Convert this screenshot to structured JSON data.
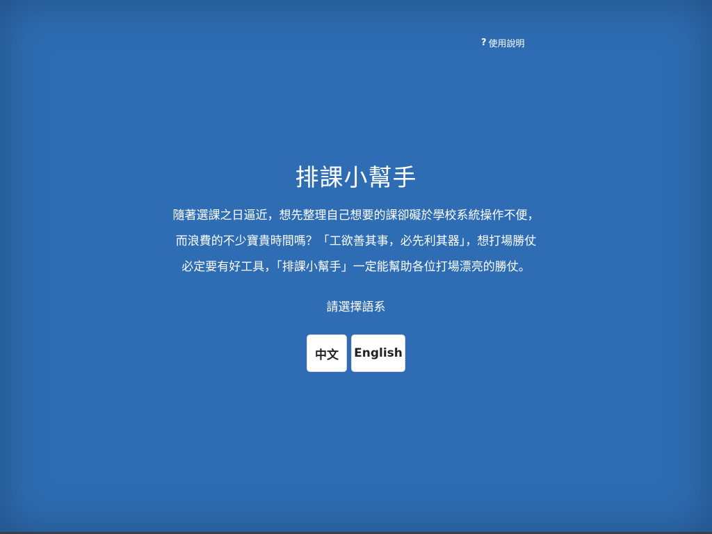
{
  "header": {
    "help_icon": "?",
    "help_label": "使用說明"
  },
  "main": {
    "title": "排課小幫手",
    "description_lines": [
      "隨著選課之日逼近，想先整理自己想要的課卻礙於學校系統操作不便，",
      "而浪費的不少寶貴時間嗎？「工欲善其事，必先利其器」，想打場勝仗",
      "必定要有好工具，「排課小幫手」一定能幫助各位打場漂亮的勝仗。"
    ],
    "language_prompt": "請選擇語系",
    "language_buttons": [
      {
        "label": "中文"
      },
      {
        "label": "English"
      }
    ]
  },
  "colors": {
    "background": "#2e6db3",
    "text": "#ffffff",
    "button_bg": "#ffffff",
    "button_text": "#222222"
  }
}
